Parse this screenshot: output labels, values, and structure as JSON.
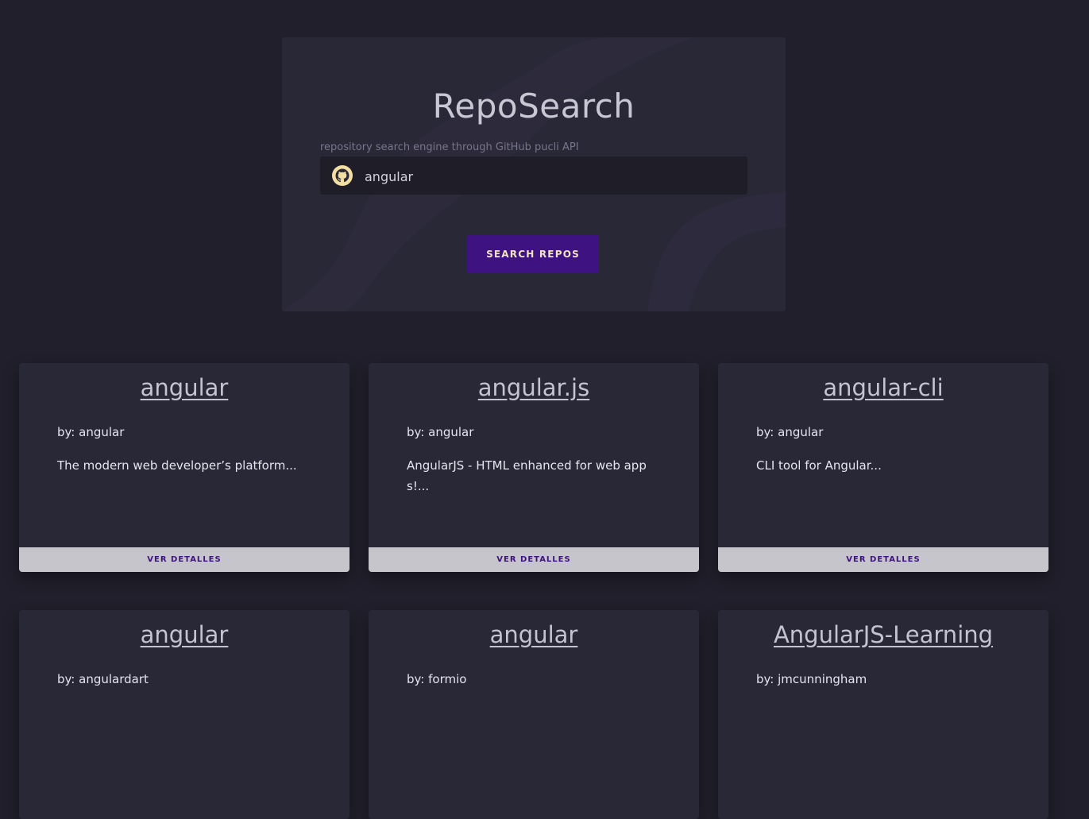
{
  "header": {
    "title": "RepoSearch",
    "subtitle": "repository search engine through GitHub pucli API",
    "search_value": "angular",
    "search_icon": "github-icon",
    "search_button": "SEARCH REPOS"
  },
  "owner_prefix": "by: ",
  "details_label": "VER DETALLES",
  "repos": [
    {
      "name": "angular",
      "owner": "angular",
      "description": "The modern web developer’s platform..."
    },
    {
      "name": "angular.js",
      "owner": "angular",
      "description": "AngularJS - HTML enhanced for web apps!..."
    },
    {
      "name": "angular-cli",
      "owner": "angular",
      "description": "CLI tool for Angular..."
    },
    {
      "name": "angular",
      "owner": "angulardart",
      "description": ""
    },
    {
      "name": "angular",
      "owner": "formio",
      "description": ""
    },
    {
      "name": "AngularJS-Learning",
      "owner": "jmcunningham",
      "description": ""
    }
  ],
  "colors": {
    "background": "#201f2b",
    "card": "#292837",
    "accent": "#3f1282",
    "button_text": "#f0e3c2"
  }
}
